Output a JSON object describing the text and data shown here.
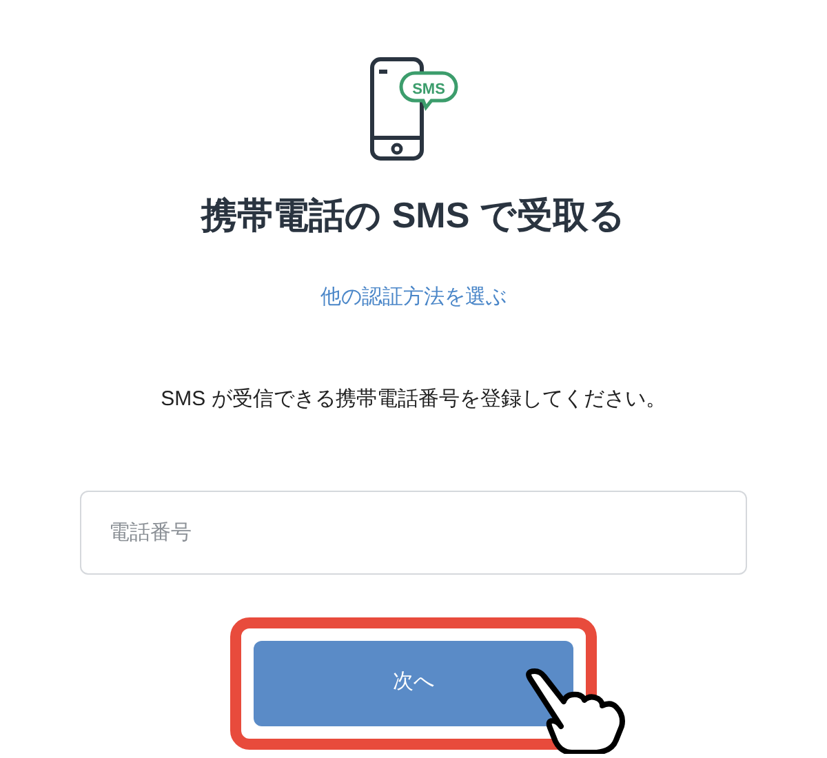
{
  "icon_label": "SMS",
  "title": "携帯電話の SMS で受取る",
  "link": "他の認証方法を選ぶ",
  "instruction": "SMS が受信できる携帯電話番号を登録してください。",
  "phone_field": {
    "placeholder": "電話番号"
  },
  "next_button": {
    "label": "次へ"
  }
}
